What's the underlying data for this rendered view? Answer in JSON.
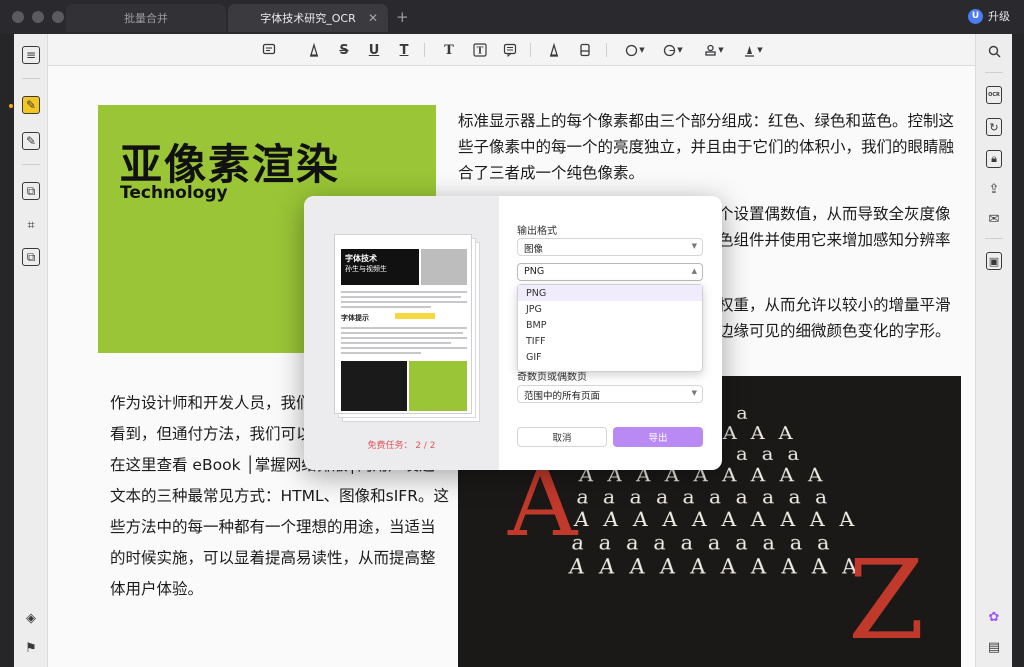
{
  "window": {
    "tabs": [
      {
        "label": "批量合并",
        "active": false
      },
      {
        "label": "字体技术研究_OCR",
        "active": true
      }
    ],
    "upgrade_badge": "U",
    "upgrade_label": "升级"
  },
  "toolbar": {
    "icons": [
      "comment-icon",
      "pen-icon",
      "strikethrough-icon",
      "underline-icon",
      "text-underline-icon",
      "text-icon",
      "text-box-icon",
      "text-callout-icon",
      "highlighter-icon",
      "eraser-icon",
      "shape-icon",
      "sticker-icon",
      "stamp-icon",
      "signature-icon"
    ],
    "glyphs": {
      "strike": "S",
      "underline": "U",
      "textu": "T",
      "text": "T"
    }
  },
  "left_sidebar": {
    "icons": [
      "thumbnail-icon",
      "annotate-icon",
      "edit-icon",
      "organize-icon",
      "crop-icon",
      "convert-icon",
      "layers-icon",
      "bookmark-icon"
    ],
    "active": "annotate-icon"
  },
  "right_sidebar": {
    "icons": [
      "search-icon",
      "ocr-icon",
      "convert-icon",
      "protect-icon",
      "share-icon",
      "email-icon",
      "save-icon",
      "ai-icon",
      "comment-list-icon"
    ],
    "ocr_label": "OCR"
  },
  "document": {
    "banner_title": "亚像素渲染",
    "banner_subtitle": "Technology",
    "paragraph_1": "标准显示器上的每个像素都由三个部分组成：红色、绿色和蓝色。控制这些子像素中的每一个的亮度独立，并且由于它们的体积小，我们的眼睛融合了三者成一个纯色像素。",
    "paragraph_2": "个设置偶数值，从而导致全灰度像色组件并使用它来增加感知分辨率",
    "paragraph_3": "权重，从而允许以较小的增量平滑边缘可见的细微颜色变化的字形。",
    "paragraph_4": "作为设计师和开发人员，我们限最终被最终用户看到，但通付方法，我们可以确保优化流我们将在这里查看 eBook │掌握网络排版│向用户发送文本的三种最常见方式：HTML、图像和sIFR。这些方法中的每一种都有一个理想的用途，当适当的时候实施，可以显着提高易读性，从而提高整体用户体验。",
    "photo_letters": "a a a a a a a\nA A A A A A A A\na a a a a a a a a\nA A A A A A A A A\na a a a a a a a a a\nA A A A A A A A A A\na a a a a a a a a a\nA A A A A A A A A A",
    "photo_big_a": "A",
    "photo_big_z": "Z"
  },
  "export_dialog": {
    "preview": {
      "heading": "字体技术",
      "subheading": "孙生与视频生",
      "section_label": "字体提示"
    },
    "free_tasks_label": "免费任务： 2 / 2",
    "output_format_label": "输出格式",
    "format_type": "图像",
    "image_format": "PNG",
    "format_options": [
      "PNG",
      "JPG",
      "BMP",
      "TIFF",
      "GIF"
    ],
    "selected_option": "PNG",
    "odd_even_label": "奇数页或偶数页",
    "page_range_value": "范围中的所有页面",
    "cancel_label": "取消",
    "export_label": "导出",
    "colors": {
      "accent": "#b98af3",
      "warning": "#e0565b",
      "banner": "#9ac536",
      "red_letter": "#c0392b"
    }
  }
}
